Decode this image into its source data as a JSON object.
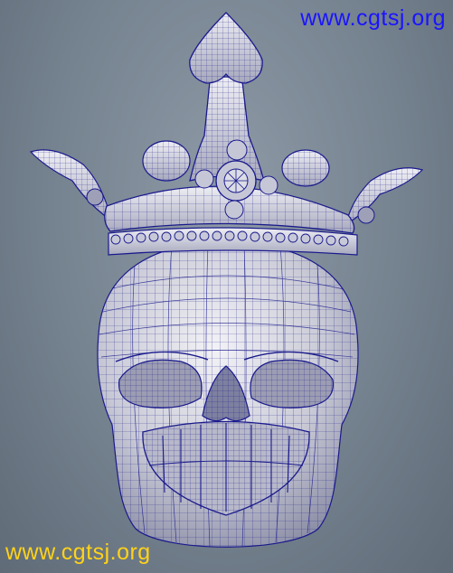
{
  "watermarks": {
    "top_right": "www.cgtsj.org",
    "bottom_left": "www.cgtsj.org"
  },
  "colors": {
    "background": "#75828f",
    "mesh_fill": "#dcdde6",
    "wireframe": "#1a1a8c",
    "watermark_top": "#1a14ff",
    "watermark_bottom": "#ffd21a"
  }
}
